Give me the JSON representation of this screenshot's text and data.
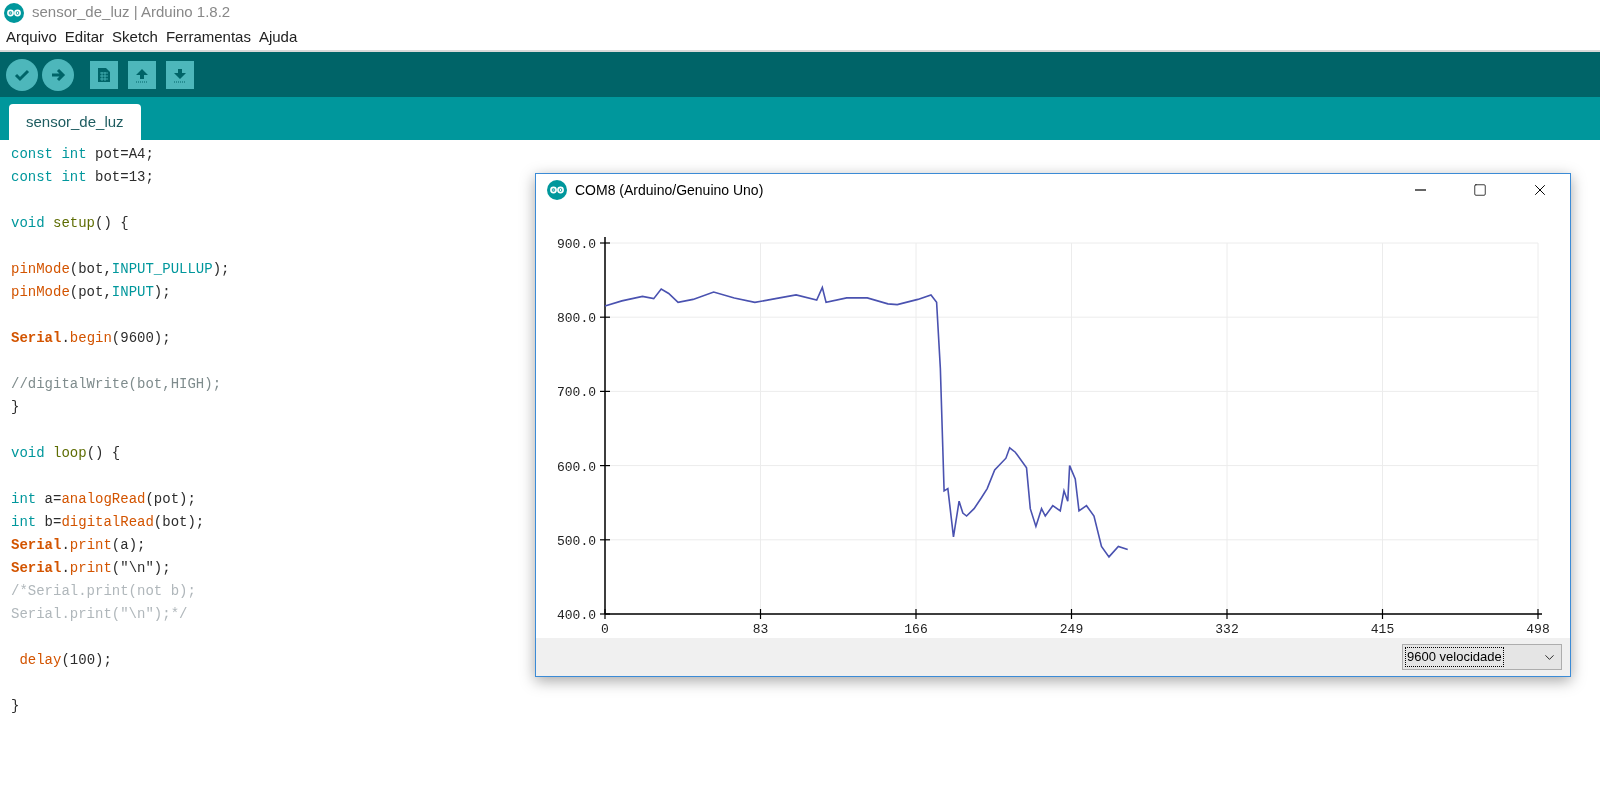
{
  "window": {
    "title": "sensor_de_luz | Arduino 1.8.2"
  },
  "menu": [
    "Arquivo",
    "Editar",
    "Sketch",
    "Ferramentas",
    "Ajuda"
  ],
  "tabs": [
    {
      "label": "sensor_de_luz",
      "selected": true
    }
  ],
  "code_lines": [
    {
      "kind": "code",
      "tokens": [
        {
          "text": "const int",
          "kind": "keyword"
        },
        {
          "text": " pot=A4;",
          "kind": "plain"
        }
      ]
    },
    {
      "kind": "code",
      "tokens": [
        {
          "text": "const int",
          "kind": "keyword"
        },
        {
          "text": " bot=13;",
          "kind": "plain"
        }
      ]
    },
    {
      "kind": "blank"
    },
    {
      "kind": "code",
      "tokens": [
        {
          "text": "void",
          "kind": "keyword"
        },
        {
          "text": " setup",
          "kind": "structure"
        },
        {
          "text": "() {",
          "kind": "plain"
        }
      ]
    },
    {
      "kind": "blank"
    },
    {
      "kind": "code",
      "tokens": [
        {
          "text": "pinMode",
          "kind": "function"
        },
        {
          "text": "(bot,",
          "kind": "plain"
        },
        {
          "text": "INPUT_PULLUP",
          "kind": "keyword"
        },
        {
          "text": ");",
          "kind": "plain"
        }
      ]
    },
    {
      "kind": "code",
      "tokens": [
        {
          "text": "pinMode",
          "kind": "function"
        },
        {
          "text": "(pot,",
          "kind": "plain"
        },
        {
          "text": "INPUT",
          "kind": "keyword"
        },
        {
          "text": ");",
          "kind": "plain"
        }
      ]
    },
    {
      "kind": "blank"
    },
    {
      "kind": "code",
      "tokens": [
        {
          "text": "Serial",
          "kind": "class"
        },
        {
          "text": ".",
          "kind": "plain"
        },
        {
          "text": "begin",
          "kind": "function"
        },
        {
          "text": "(9600);",
          "kind": "plain"
        }
      ]
    },
    {
      "kind": "blank"
    },
    {
      "kind": "code",
      "tokens": [
        {
          "text": "//digitalWrite(bot,HIGH);",
          "kind": "comment"
        }
      ]
    },
    {
      "kind": "code",
      "tokens": [
        {
          "text": "}",
          "kind": "plain"
        }
      ]
    },
    {
      "kind": "blank"
    },
    {
      "kind": "code",
      "tokens": [
        {
          "text": "void",
          "kind": "keyword"
        },
        {
          "text": " loop",
          "kind": "structure"
        },
        {
          "text": "() {",
          "kind": "plain"
        }
      ]
    },
    {
      "kind": "blank"
    },
    {
      "kind": "code",
      "tokens": [
        {
          "text": "int",
          "kind": "keyword"
        },
        {
          "text": " a=",
          "kind": "plain"
        },
        {
          "text": "analogRead",
          "kind": "function"
        },
        {
          "text": "(pot);",
          "kind": "plain"
        }
      ]
    },
    {
      "kind": "code",
      "tokens": [
        {
          "text": "int",
          "kind": "keyword"
        },
        {
          "text": " b=",
          "kind": "plain"
        },
        {
          "text": "digitalRead",
          "kind": "function"
        },
        {
          "text": "(bot);",
          "kind": "plain"
        }
      ]
    },
    {
      "kind": "code",
      "tokens": [
        {
          "text": "Serial",
          "kind": "class"
        },
        {
          "text": ".",
          "kind": "plain"
        },
        {
          "text": "print",
          "kind": "function"
        },
        {
          "text": "(a);",
          "kind": "plain"
        }
      ]
    },
    {
      "kind": "code",
      "tokens": [
        {
          "text": "Serial",
          "kind": "class"
        },
        {
          "text": ".",
          "kind": "plain"
        },
        {
          "text": "print",
          "kind": "function"
        },
        {
          "text": "(\"\\n\");",
          "kind": "plain"
        }
      ]
    },
    {
      "kind": "code",
      "tokens": [
        {
          "text": "/*Serial.print(not b);",
          "kind": "comment2"
        }
      ]
    },
    {
      "kind": "code",
      "tokens": [
        {
          "text": "Serial.print(\"\\n\");*/",
          "kind": "comment2"
        }
      ]
    },
    {
      "kind": "blank"
    },
    {
      "kind": "code",
      "tokens": [
        {
          "text": " delay",
          "kind": "function"
        },
        {
          "text": "(100);",
          "kind": "plain"
        }
      ]
    },
    {
      "kind": "blank"
    },
    {
      "kind": "code",
      "tokens": [
        {
          "text": "}",
          "kind": "plain"
        }
      ]
    }
  ],
  "plotter": {
    "title": "COM8 (Arduino/Genuino Uno)",
    "chart_data": {
      "type": "line",
      "grid": true,
      "xlim": [
        0,
        498
      ],
      "ylim": [
        400,
        900
      ],
      "xticks": [
        0,
        83,
        166,
        249,
        332,
        415,
        498
      ],
      "yticks": [
        {
          "value": 400,
          "label": "400.0"
        },
        {
          "value": 500,
          "label": "500.0"
        },
        {
          "value": 600,
          "label": "600.0"
        },
        {
          "value": 700,
          "label": "700.0"
        },
        {
          "value": 800,
          "label": "800.0"
        },
        {
          "value": 900,
          "label": "900.0"
        }
      ],
      "x": [
        0,
        9,
        20,
        26,
        30,
        34,
        39,
        47,
        58,
        69,
        80,
        91,
        102,
        113,
        116,
        118,
        129,
        140,
        151,
        156,
        167,
        174,
        177,
        179,
        181,
        183,
        186,
        189,
        191,
        193,
        197,
        201,
        204,
        208,
        214,
        216,
        219,
        225,
        227,
        230,
        233,
        235,
        239,
        243,
        245,
        247,
        248,
        251,
        253,
        257,
        261,
        265,
        269,
        274,
        279
      ],
      "series": [
        {
          "color": "#4a52b0",
          "values": [
            815,
            822,
            828,
            825,
            838,
            832,
            820,
            824,
            834,
            826,
            820,
            825,
            830,
            823,
            840,
            820,
            826,
            826,
            818,
            817,
            824,
            830,
            820,
            731,
            566,
            569,
            504,
            552,
            536,
            532,
            542,
            557,
            569,
            594,
            610,
            624,
            618,
            597,
            542,
            518,
            542,
            532,
            546,
            539,
            566,
            552,
            600,
            582,
            539,
            546,
            532,
            491,
            477,
            491,
            487
          ]
        }
      ]
    },
    "baud": {
      "value": "9600 velocidade"
    }
  }
}
